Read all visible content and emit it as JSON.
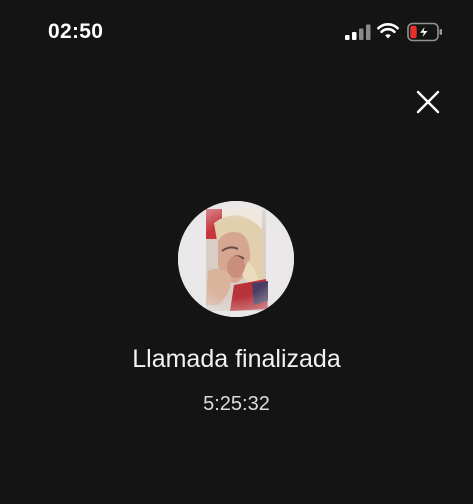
{
  "status_bar": {
    "time": "02:50",
    "icons": [
      "signal-icon",
      "wifi-icon",
      "battery-charging-icon"
    ],
    "battery_level": 0.2
  },
  "header": {
    "close_icon": "close-icon"
  },
  "call": {
    "avatar_icon": "contact-avatar",
    "status": "Llamada finalizada",
    "duration": "5:25:32"
  },
  "colors": {
    "background": "#141414",
    "text": "#ffffff",
    "battery_low": "#e0312b"
  }
}
